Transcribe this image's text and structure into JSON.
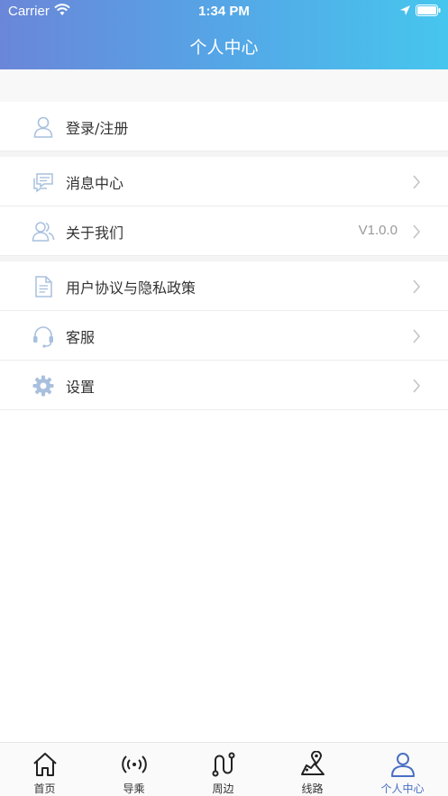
{
  "status_bar": {
    "carrier": "Carrier",
    "time": "1:34 PM"
  },
  "header": {
    "title": "个人中心"
  },
  "login": {
    "label": "登录/注册"
  },
  "menu_group_1": [
    {
      "label": "消息中心",
      "value": ""
    },
    {
      "label": "关于我们",
      "value": "V1.0.0"
    }
  ],
  "menu_group_2": [
    {
      "label": "用户协议与隐私政策"
    },
    {
      "label": "客服"
    },
    {
      "label": "设置"
    }
  ],
  "tabbar": {
    "items": [
      {
        "label": "首页",
        "icon": "home-icon"
      },
      {
        "label": "导乘",
        "icon": "broadcast-icon"
      },
      {
        "label": "周边",
        "icon": "route-icon"
      },
      {
        "label": "线路",
        "icon": "map-pin-icon"
      },
      {
        "label": "个人中心",
        "icon": "person-icon"
      }
    ],
    "active_index": 4
  },
  "colors": {
    "accent": "#4a6fc4",
    "icon_light": "#a8c0de"
  }
}
